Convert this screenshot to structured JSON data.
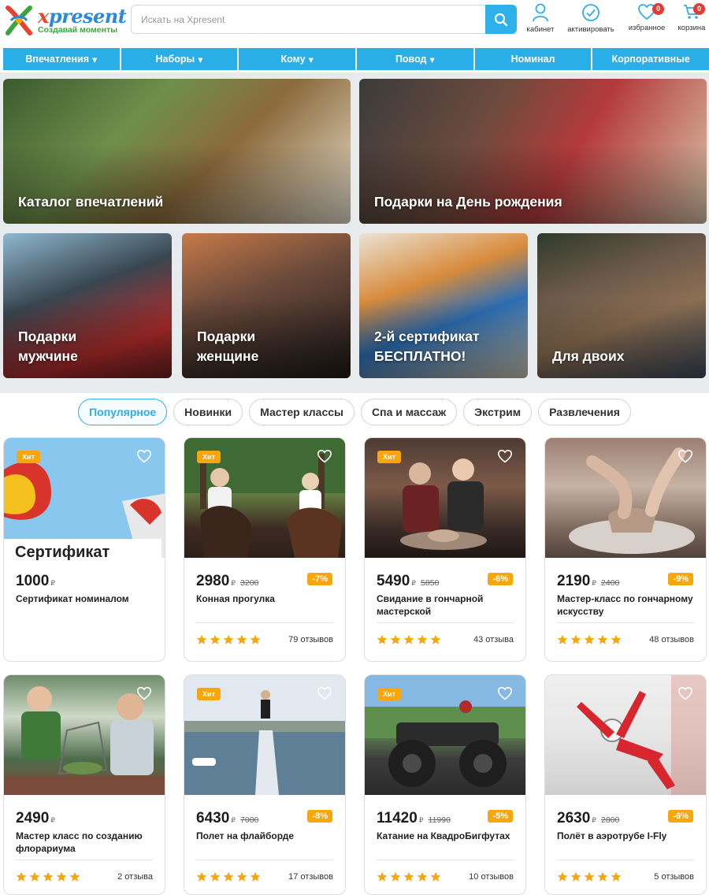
{
  "header": {
    "logo_text": "present",
    "logo_x": "x",
    "logo_tagline": "Создавай моменты",
    "search_placeholder": "Искать на Xpresent",
    "icons": [
      {
        "label": "кабинет",
        "icon": "user-icon"
      },
      {
        "label": "активировать",
        "icon": "check-circle-icon"
      },
      {
        "label": "избранное",
        "icon": "heart-icon",
        "badge": "0"
      },
      {
        "label": "корзина",
        "icon": "cart-icon",
        "badge": "0"
      }
    ]
  },
  "nav": [
    {
      "label": "Впечатления",
      "dropdown": true
    },
    {
      "label": "Наборы",
      "dropdown": true
    },
    {
      "label": "Кому",
      "dropdown": true
    },
    {
      "label": "Повод",
      "dropdown": true
    },
    {
      "label": "Номинал",
      "dropdown": false
    },
    {
      "label": "Корпоративные",
      "dropdown": false
    }
  ],
  "banners": [
    {
      "title": "Каталог впечатлений"
    },
    {
      "title": "Подарки на День рождения"
    },
    {
      "title": "Подарки мужчине"
    },
    {
      "title": "Подарки женщине"
    },
    {
      "title": "2-й сертификат БЕСПЛАТНО!"
    },
    {
      "title": "Для двоих"
    }
  ],
  "tabs": [
    {
      "label": "Популярное",
      "active": true
    },
    {
      "label": "Новинки"
    },
    {
      "label": "Мастер классы"
    },
    {
      "label": "Спа и массаж"
    },
    {
      "label": "Экстрим"
    },
    {
      "label": "Развлечения"
    }
  ],
  "products": [
    {
      "price": "1000",
      "currency": "₽",
      "old_price": "",
      "discount": "",
      "hit": "Хит",
      "name": "Сертификат номиналом",
      "rating": 5,
      "reviews": "",
      "image_text": "Сертификат"
    },
    {
      "price": "2980",
      "currency": "₽",
      "old_price": "3200",
      "discount": "-7%",
      "hit": "Хит",
      "name": "Конная прогулка",
      "rating": 5,
      "reviews": "79 отзывов"
    },
    {
      "price": "5490",
      "currency": "₽",
      "old_price": "5850",
      "discount": "-6%",
      "hit": "Хит",
      "name": "Свидание в гончарной мастерской",
      "rating": 5,
      "reviews": "43 отзыва"
    },
    {
      "price": "2190",
      "currency": "₽",
      "old_price": "2400",
      "discount": "-9%",
      "hit": "",
      "name": "Мастер-класс по гончарному искусству",
      "rating": 5,
      "reviews": "48 отзывов"
    },
    {
      "price": "2490",
      "currency": "₽",
      "old_price": "",
      "discount": "",
      "hit": "",
      "name": "Мастер класс по созданию флорариума",
      "rating": 5,
      "reviews": "2 отзыва"
    },
    {
      "price": "6430",
      "currency": "₽",
      "old_price": "7000",
      "discount": "-8%",
      "hit": "Хит",
      "name": "Полет на флайборде",
      "rating": 5,
      "reviews": "17 отзывов"
    },
    {
      "price": "11420",
      "currency": "₽",
      "old_price": "11990",
      "discount": "-5%",
      "hit": "Хит",
      "name": "Катание на КвадроБигфутах",
      "rating": 5,
      "reviews": "10 отзывов"
    },
    {
      "price": "2630",
      "currency": "₽",
      "old_price": "2800",
      "discount": "-6%",
      "hit": "",
      "name": "Полёт в аэротрубе I-Fly",
      "rating": 5,
      "reviews": "5 отзывов"
    }
  ],
  "colors": {
    "accent": "#29aee8",
    "badge": "#f7a70d",
    "alert": "#e53935",
    "brand_green": "#3aa53a",
    "brand_blue": "#2b8bd6"
  }
}
